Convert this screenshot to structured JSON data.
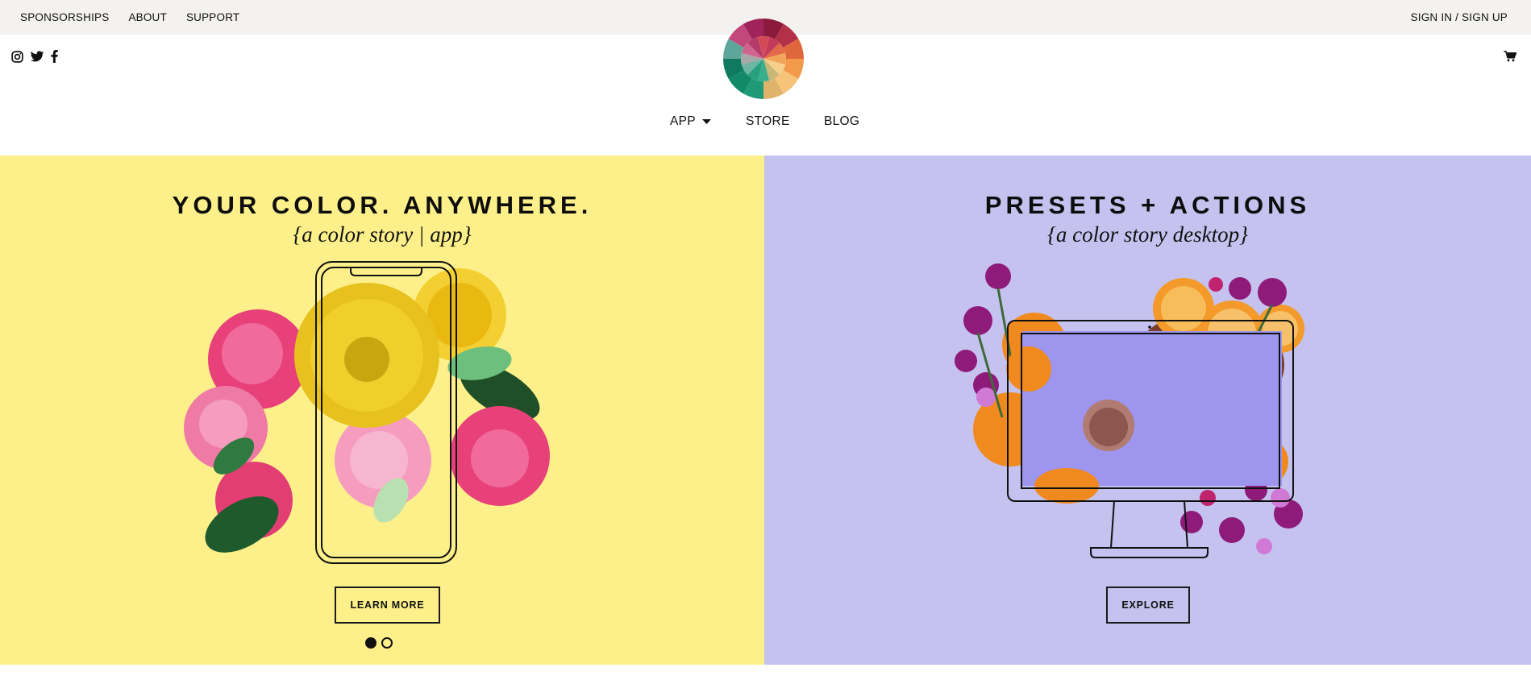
{
  "topbar": {
    "links": [
      "SPONSORSHIPS",
      "ABOUT",
      "SUPPORT"
    ],
    "signin": "SIGN IN / SIGN UP"
  },
  "social": {
    "icons": [
      "instagram-icon",
      "twitter-icon",
      "facebook-icon"
    ]
  },
  "cart": {
    "icon": "cart-icon"
  },
  "logo": {
    "icon": "color-wheel-logo"
  },
  "nav": {
    "app": "APP",
    "store": "STORE",
    "blog": "BLOG"
  },
  "hero_left": {
    "title": "YOUR COLOR. ANYWHERE.",
    "subtitle": "{a color story  |  app}",
    "button": "LEARN MORE",
    "background": "#fdf08a"
  },
  "hero_right": {
    "title": "PRESETS + ACTIONS",
    "subtitle": "{a color story desktop}",
    "button": "EXPLORE",
    "background": "#c5c2ef"
  },
  "carousel": {
    "total": 2,
    "active": 1
  }
}
